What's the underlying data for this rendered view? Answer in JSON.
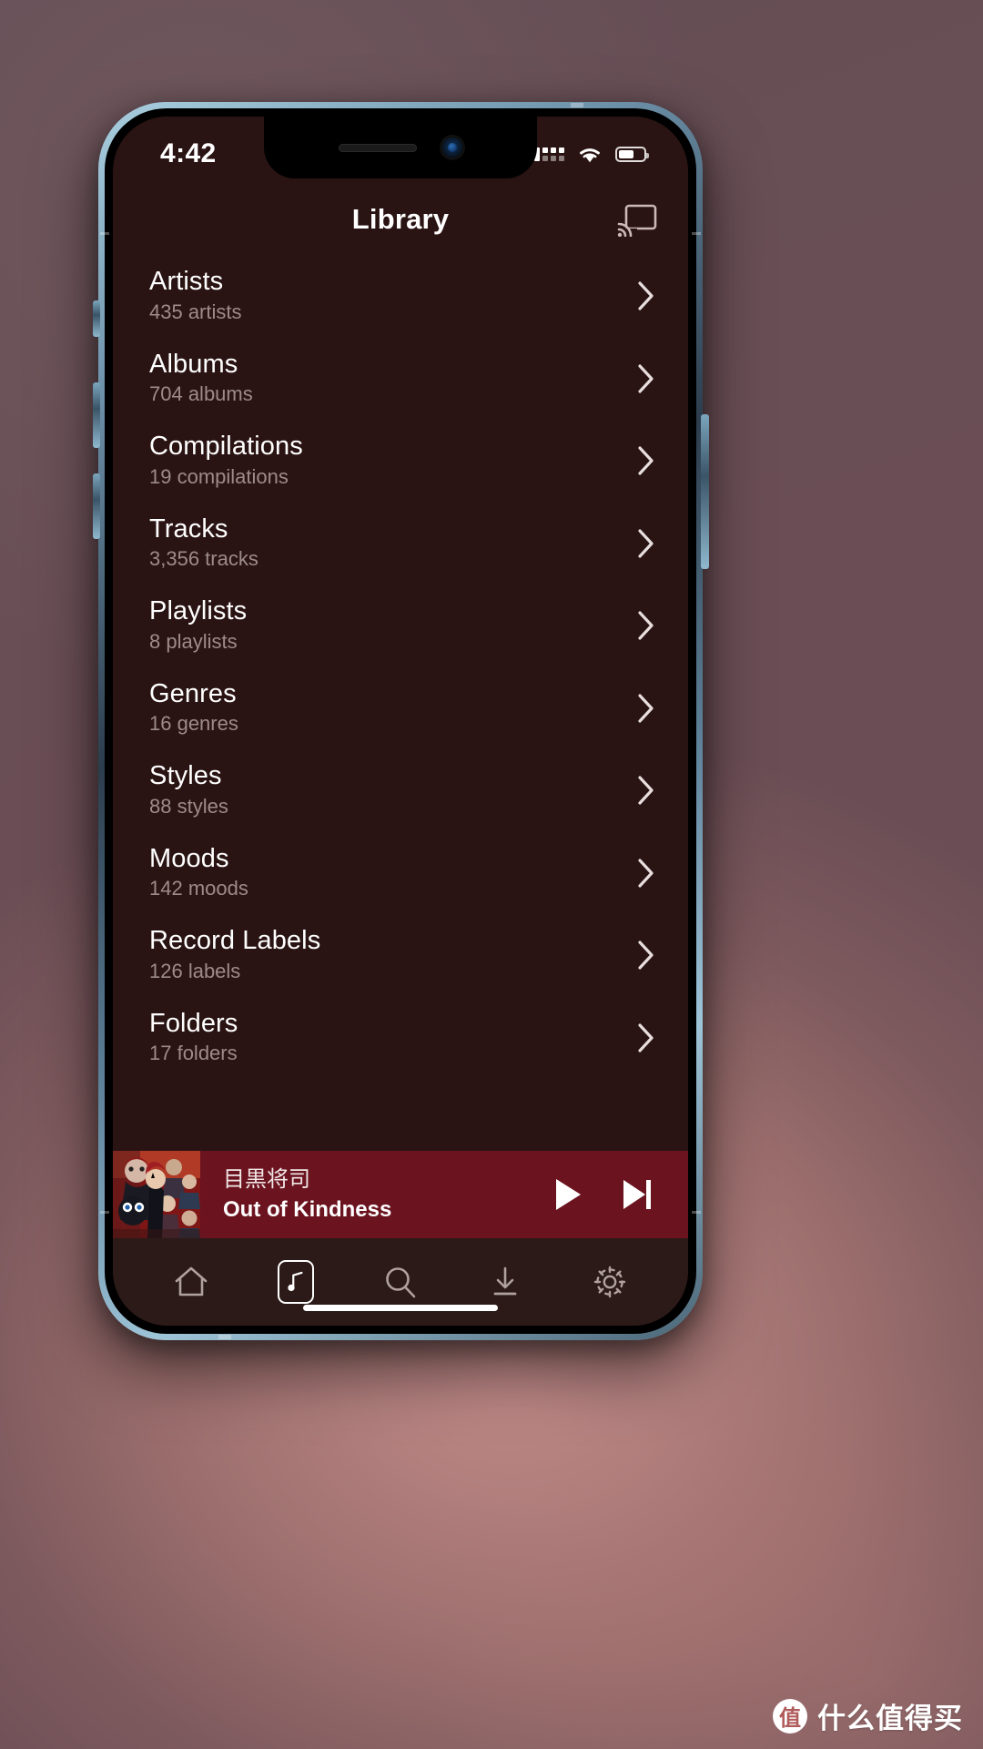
{
  "status_bar": {
    "time": "4:42",
    "signal_icon": "cellular-grid-icon",
    "wifi_icon": "wifi-icon",
    "battery_icon": "battery-icon",
    "battery_level_pct": 62
  },
  "header": {
    "title": "Library",
    "cast_icon": "cast-icon"
  },
  "library": {
    "items": [
      {
        "title": "Artists",
        "subtitle": "435 artists",
        "chevron": "chevron-right-icon"
      },
      {
        "title": "Albums",
        "subtitle": "704 albums",
        "chevron": "chevron-right-icon"
      },
      {
        "title": "Compilations",
        "subtitle": "19 compilations",
        "chevron": "chevron-right-icon"
      },
      {
        "title": "Tracks",
        "subtitle": "3,356 tracks",
        "chevron": "chevron-right-icon"
      },
      {
        "title": "Playlists",
        "subtitle": "8 playlists",
        "chevron": "chevron-right-icon"
      },
      {
        "title": "Genres",
        "subtitle": "16 genres",
        "chevron": "chevron-right-icon"
      },
      {
        "title": "Styles",
        "subtitle": "88 styles",
        "chevron": "chevron-right-icon"
      },
      {
        "title": "Moods",
        "subtitle": "142 moods",
        "chevron": "chevron-right-icon"
      },
      {
        "title": "Record Labels",
        "subtitle": "126 labels",
        "chevron": "chevron-right-icon"
      },
      {
        "title": "Folders",
        "subtitle": "17 folders",
        "chevron": "chevron-right-icon"
      }
    ]
  },
  "now_playing": {
    "artist": "目黒将司",
    "track": "Out of Kindness",
    "artwork_name": "album-artwork",
    "play_icon": "play-icon",
    "next_icon": "skip-next-icon",
    "bar_color": "#6b1420"
  },
  "bottom_nav": {
    "items": [
      {
        "name": "home",
        "icon": "home-icon",
        "active": false
      },
      {
        "name": "library",
        "icon": "music-note-icon",
        "active": true
      },
      {
        "name": "search",
        "icon": "search-icon",
        "active": false
      },
      {
        "name": "download",
        "icon": "download-icon",
        "active": false
      },
      {
        "name": "settings",
        "icon": "gear-icon",
        "active": false
      }
    ]
  },
  "watermark": {
    "badge": "值",
    "text": "什么值得买"
  },
  "theme": {
    "screen_bg": "#2a1413",
    "accent": "#6b1420",
    "nav_bg": "#2b1a17",
    "text_primary": "#ffffff",
    "text_secondary": "#9d8b8a"
  }
}
